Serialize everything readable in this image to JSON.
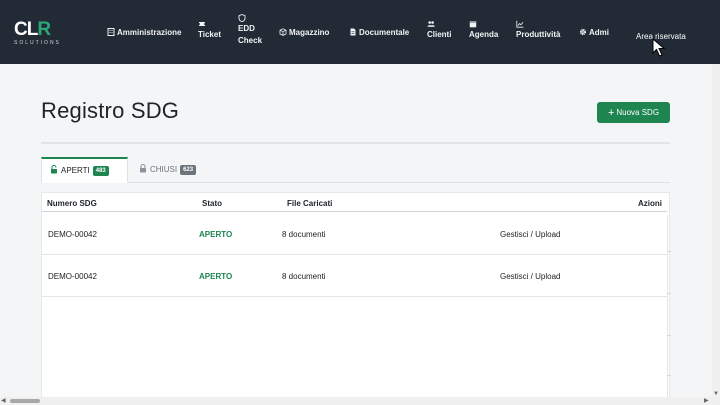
{
  "brand": {
    "mark_left": "CL",
    "mark_right": "R",
    "sub": "SOLUTIONS"
  },
  "nav": {
    "items": [
      {
        "label": "Amministrazione",
        "icon": "building-icon"
      },
      {
        "label": "Ticket",
        "icon": "ticket-icon"
      },
      {
        "label_line1": "EDD",
        "label_line2": "Check",
        "icon": "shield-icon"
      },
      {
        "label": "Magazzino",
        "icon": "box-icon"
      },
      {
        "label": "Documentale",
        "icon": "document-icon"
      },
      {
        "label": "Clienti",
        "icon": "users-icon"
      },
      {
        "label": "Agenda",
        "icon": "calendar-icon"
      },
      {
        "label": "Produttività",
        "icon": "chart-icon"
      },
      {
        "label": "Admi",
        "icon": "gear-icon"
      }
    ],
    "area_link": "Area riservata"
  },
  "page": {
    "title": "Registro SDG",
    "new_button": "Nuova SDG"
  },
  "tabs": [
    {
      "label": "APERTI",
      "count": "483",
      "active": true
    },
    {
      "label": "CHIUSI",
      "count": "623",
      "active": false
    }
  ],
  "table": {
    "headers": {
      "numero": "Numero SDG",
      "stato": "Stato",
      "file": "File Caricati",
      "azioni": "Azioni"
    },
    "rows": [
      {
        "numero": "DEMO-00042",
        "stato": "APERTO",
        "file": "8 documenti",
        "azioni": "Gestisci / Upload"
      },
      {
        "numero": "DEMO-00042",
        "stato": "APERTO",
        "file": "8 documenti",
        "azioni": "Gestisci / Upload"
      }
    ]
  },
  "colors": {
    "navbar": "#222b35",
    "accent": "#1e8551",
    "background": "#f4f5f7"
  }
}
